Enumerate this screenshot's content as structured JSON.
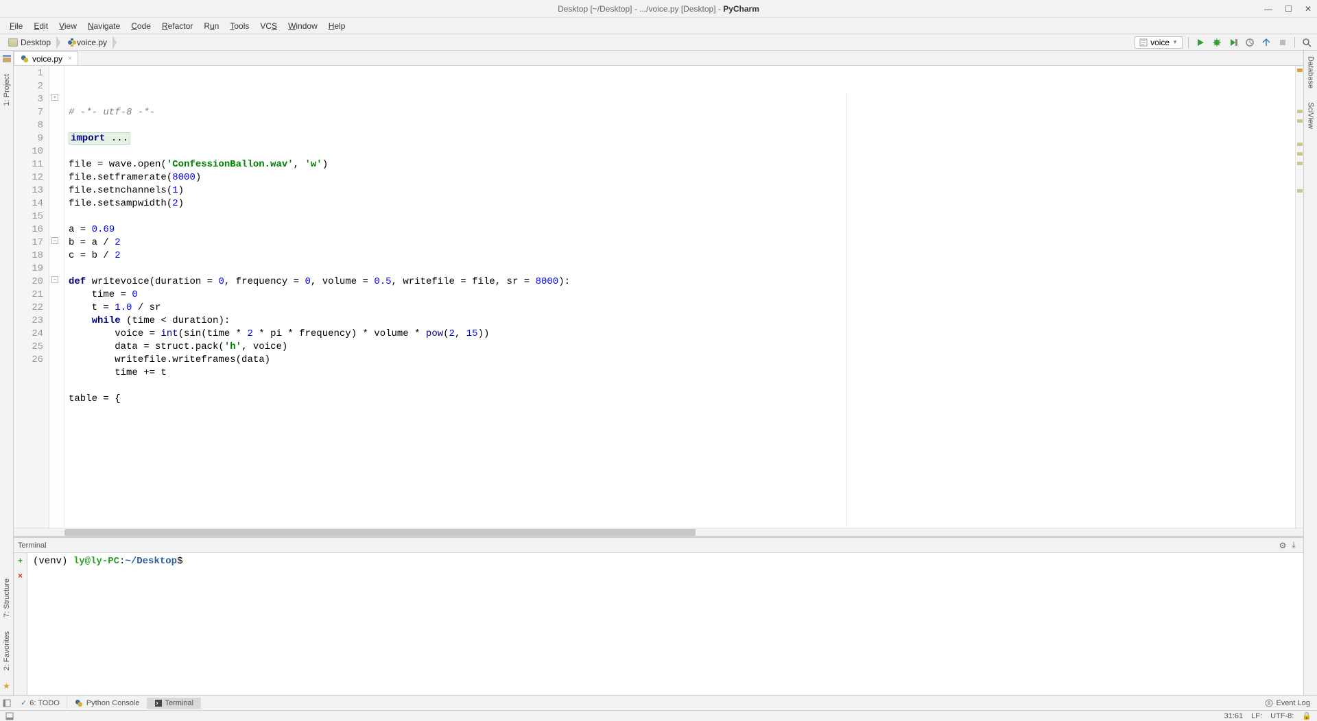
{
  "window": {
    "title_prefix": "Desktop [~/Desktop] - .../voice.py [Desktop] - ",
    "title_app": "PyCharm"
  },
  "menu": {
    "items": [
      "File",
      "Edit",
      "View",
      "Navigate",
      "Code",
      "Refactor",
      "Run",
      "Tools",
      "VCS",
      "Window",
      "Help"
    ]
  },
  "breadcrumbs": {
    "items": [
      {
        "label": "Desktop",
        "icon": "folder"
      },
      {
        "label": "voice.py",
        "icon": "python"
      }
    ]
  },
  "run_config": {
    "label": "voice"
  },
  "tabs": [
    {
      "label": "voice.py"
    }
  ],
  "code": {
    "lines": [
      {
        "n": 1,
        "html": "<span class='cmt'># -*- utf-8 -*-</span>"
      },
      {
        "n": 2,
        "html": ""
      },
      {
        "n": 3,
        "html": "<span class='fold-box'><span class='kw'>import</span> ...</span>"
      },
      {
        "n": 7,
        "html": ""
      },
      {
        "n": 8,
        "html": "file = wave.open(<span class='str'>'ConfessionBallon.wav'</span>, <span class='str'>'w'</span>)"
      },
      {
        "n": 9,
        "html": "file.setframerate(<span class='num'>8000</span>)"
      },
      {
        "n": 10,
        "html": "file.setnchannels(<span class='num'>1</span>)"
      },
      {
        "n": 11,
        "html": "file.setsampwidth(<span class='num'>2</span>)"
      },
      {
        "n": 12,
        "html": ""
      },
      {
        "n": 13,
        "html": "a = <span class='num'>0.69</span>"
      },
      {
        "n": 14,
        "html": "b = a / <span class='num'>2</span>"
      },
      {
        "n": 15,
        "html": "c = b / <span class='num'>2</span>"
      },
      {
        "n": 16,
        "html": ""
      },
      {
        "n": 17,
        "html": "<span class='kw'>def</span> writevoice(duration = <span class='num'>0</span>, frequency = <span class='num'>0</span>, volume = <span class='num'>0.5</span>, writefile = file, sr = <span class='num'>8000</span>):"
      },
      {
        "n": 18,
        "html": "    time = <span class='num'>0</span>"
      },
      {
        "n": 19,
        "html": "    t = <span class='num'>1.0</span> / sr"
      },
      {
        "n": 20,
        "html": "    <span class='kw'>while</span> (time &lt; duration):"
      },
      {
        "n": 21,
        "html": "        voice = <span class='builtin'>int</span>(sin(time * <span class='num'>2</span> * pi * frequency) * volume * <span class='builtin'>pow</span>(<span class='num'>2</span>, <span class='num'>15</span>))"
      },
      {
        "n": 22,
        "html": "        data = struct.pack(<span class='str'>'h'</span>, voice)"
      },
      {
        "n": 23,
        "html": "        writefile.writeframes(data)"
      },
      {
        "n": 24,
        "html": "        time += t"
      },
      {
        "n": 25,
        "html": ""
      },
      {
        "n": 26,
        "html": "table = {"
      }
    ]
  },
  "terminal": {
    "title": "Terminal",
    "venv": "(venv) ",
    "user": "ly@ly-PC",
    "colon": ":",
    "path": "~/Desktop",
    "dollar": "$ "
  },
  "bottom_tabs": {
    "todo": "6: TODO",
    "python_console": "Python Console",
    "terminal": "Terminal",
    "event_log": "Event Log"
  },
  "left_tabs": {
    "project": "1: Project",
    "structure": "7: Structure",
    "favorites": "2: Favorites"
  },
  "right_tabs": {
    "database": "Database",
    "sciview": "SciView"
  },
  "status": {
    "pos": "31:61",
    "lf": "LF:",
    "enc": "UTF-8:"
  }
}
